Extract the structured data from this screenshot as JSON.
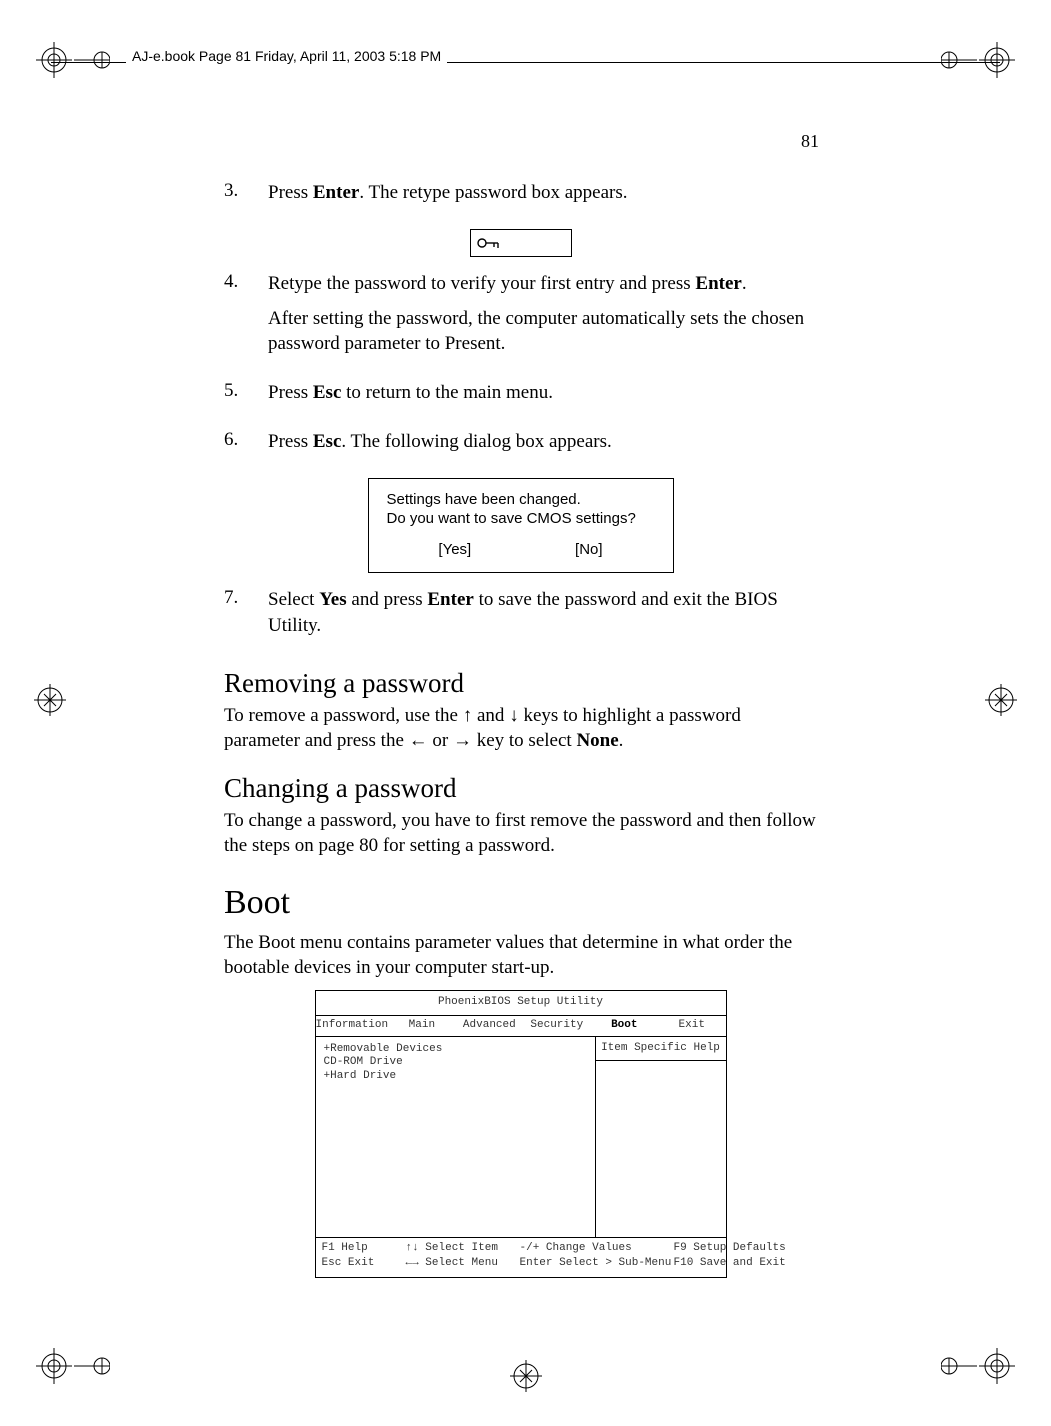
{
  "header": {
    "text": "AJ-e.book  Page 81  Friday, April 11, 2003  5:18 PM"
  },
  "page_number": "81",
  "step3": {
    "num": "3.",
    "text_a": "Press ",
    "bold_a": "Enter",
    "text_b": ".  The retype password box appears."
  },
  "step4": {
    "num": "4.",
    "line1_a": "Retype the password to verify your first entry and press ",
    "line1_bold": "Enter",
    "line1_b": ".",
    "line2": "After setting the password, the computer automatically sets the chosen password parameter to Present."
  },
  "step5": {
    "num": "5.",
    "text_a": "Press ",
    "bold_a": "Esc",
    "text_b": " to return to the main menu."
  },
  "step6": {
    "num": "6.",
    "text_a": "Press ",
    "bold_a": "Esc",
    "text_b": ".  The following dialog box appears."
  },
  "dialog": {
    "line1": "Settings have been changed.",
    "line2": "Do you want to save CMOS settings?",
    "yes": "[Yes]",
    "no": "[No]"
  },
  "step7": {
    "num": "7.",
    "text_a": "Select ",
    "bold_a": "Yes",
    "text_b": " and press ",
    "bold_b": "Enter",
    "text_c": " to save the password and exit the BIOS Utility."
  },
  "removing": {
    "heading": "Removing a password",
    "text_a": "To remove a password, use the ",
    "up": "↑",
    "text_b": " and ",
    "down": "↓",
    "text_c": " keys to highlight a password parameter and press the ",
    "left": "←",
    "text_d": " or  ",
    "right": "→",
    "text_e": " key to select ",
    "bold": "None",
    "text_f": "."
  },
  "changing": {
    "heading": "Changing a password",
    "text": "To change a password, you have to first remove the password and then follow the steps on page 80 for setting a password."
  },
  "boot": {
    "heading": "Boot",
    "text": "The Boot menu contains parameter values that determine in what order the bootable devices in your computer start-up."
  },
  "bios": {
    "title": "PhoenixBIOS Setup Utility",
    "menu": [
      "Information",
      "Main",
      "Advanced",
      "Security",
      "Boot",
      "Exit"
    ],
    "selected": "Boot",
    "left_items": [
      "+Removable Devices",
      " CD-ROM Drive",
      "+Hard Drive"
    ],
    "right_head": "Item Specific Help",
    "footer": {
      "r1c1": "F1  Help",
      "r1c2": "↑↓ Select Item",
      "r1c3": "-/+ Change Values",
      "r1c4": "F9  Setup Defaults",
      "r2c1": "Esc Exit",
      "r2c2": "←→ Select Menu",
      "r2c3": "Enter Select > Sub-Menu",
      "r2c4": "F10 Save and Exit"
    }
  }
}
